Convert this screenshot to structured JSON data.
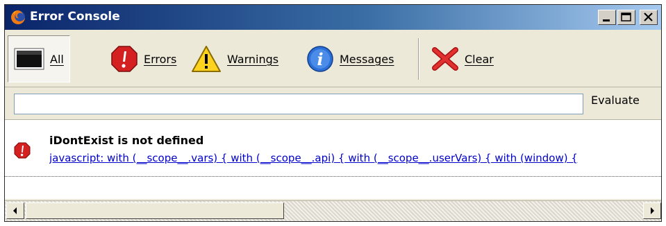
{
  "window": {
    "title": "Error Console",
    "controls": {
      "minimize": "minimize-icon",
      "maximize": "maximize-icon",
      "close": "close-icon"
    }
  },
  "toolbar": {
    "all_label": "All",
    "errors_label": "Errors",
    "warnings_label": "Warnings",
    "messages_label": "Messages",
    "clear_label": "Clear",
    "active": "All"
  },
  "evaluate": {
    "input_value": "",
    "button_label": "Evaluate"
  },
  "messages": [
    {
      "type": "error",
      "icon": "error-icon",
      "title": "iDontExist is not defined",
      "source": "javascript: with (__scope__.vars) { with (__scope__.api) { with (__scope__.userVars) { with (window) {"
    }
  ],
  "colors": {
    "titlebar_start": "#0a246a",
    "titlebar_end": "#a6caf0",
    "error_red": "#d42020",
    "warning_yellow": "#ffd21e",
    "info_blue": "#2c6fd6",
    "link_blue": "#0000cc"
  }
}
